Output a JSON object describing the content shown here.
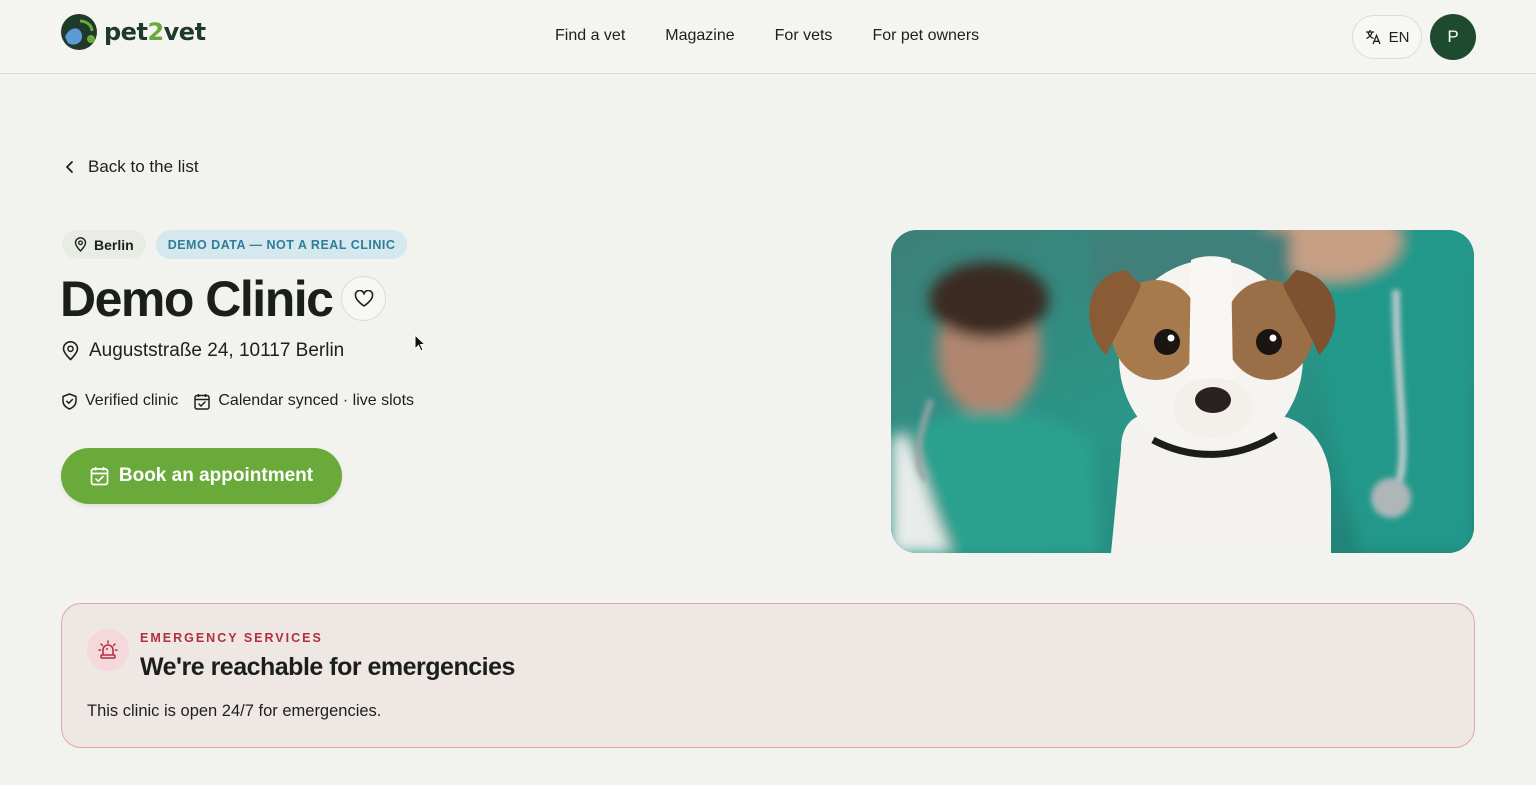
{
  "header": {
    "logo_text_a": "pet",
    "logo_text_b": "2",
    "logo_text_c": "vet",
    "nav": [
      "Find a vet",
      "Magazine",
      "For vets",
      "For pet owners"
    ],
    "language": "EN",
    "avatar_initial": "P"
  },
  "back_link": "Back to the list",
  "clinic": {
    "city": "Berlin",
    "demo_badge": "DEMO DATA — NOT A REAL CLINIC",
    "name": "Demo Clinic",
    "address": "Auguststraße 24, 10117 Berlin",
    "badges": [
      "Verified clinic",
      "Calendar synced · live slots"
    ],
    "book_label": "Book an appointment"
  },
  "emergency": {
    "kicker": "EMERGENCY SERVICES",
    "title": "We're reachable for emergencies",
    "text": "This clinic is open 24/7 for emergencies."
  },
  "icons": {
    "back": "chevron-left-icon",
    "city": "map-pin-icon",
    "favorite": "heart-icon",
    "language": "translate-icon",
    "verified": "shield-check-icon",
    "calendar": "calendar-check-icon",
    "emergency": "siren-icon"
  },
  "colors": {
    "brand_green": "#6aaa3a",
    "dark_green": "#1e4a2f",
    "demo_badge_bg": "#d5e8ee",
    "emergency_red": "#b0303f"
  }
}
